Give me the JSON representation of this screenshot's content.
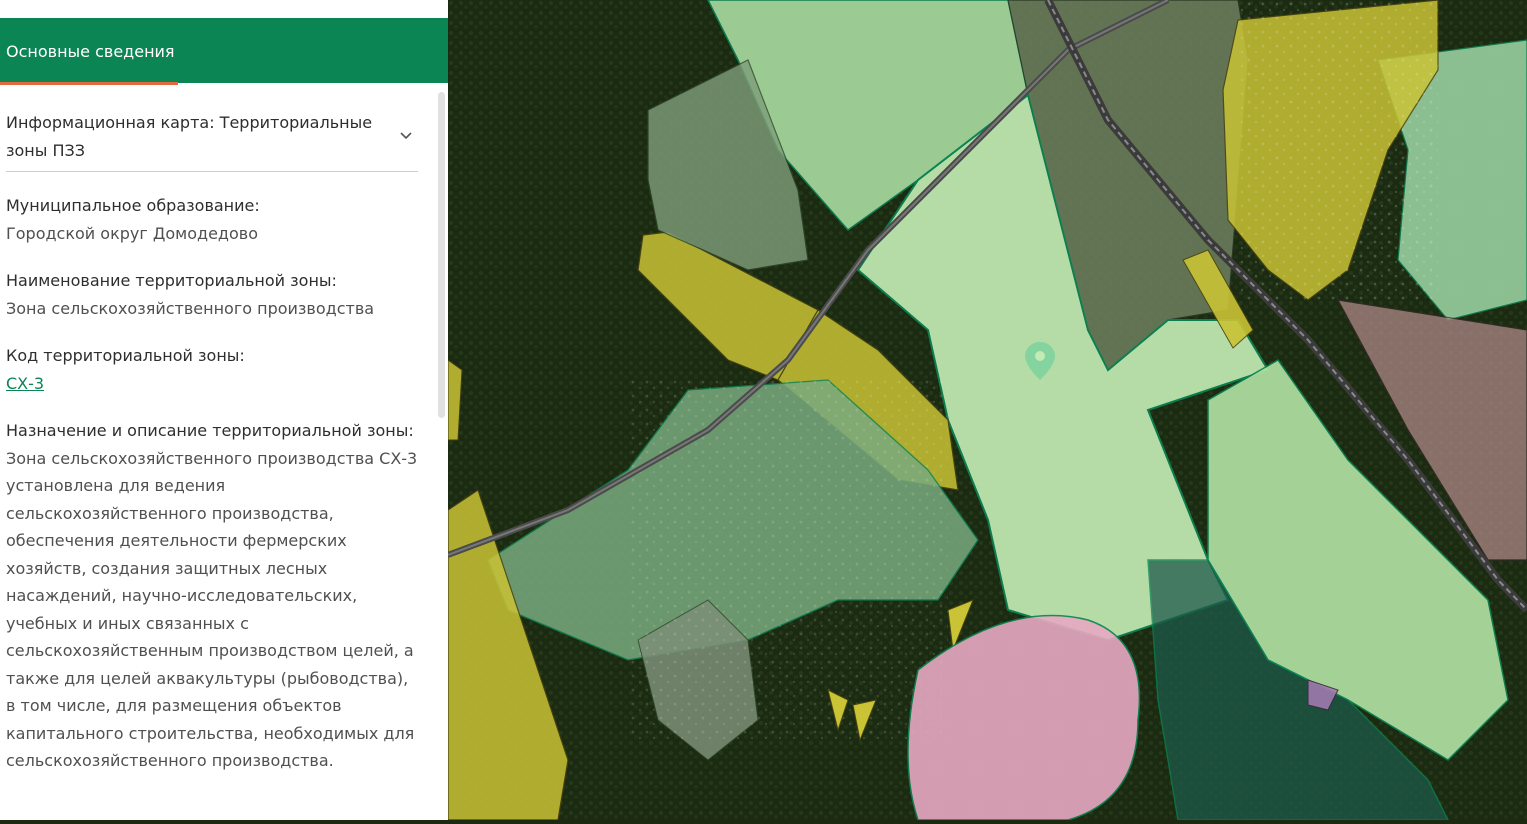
{
  "panel": {
    "header_title": "Основные сведения",
    "dropdown": "Информационная карта: Территориальные зоны ПЗЗ",
    "fields": [
      {
        "label": "Муниципальное образование:",
        "value": "Городской округ Домодедово"
      },
      {
        "label": "Наименование территориальной зоны:",
        "value": "Зона сельскохозяйственного производства"
      },
      {
        "label": "Код территориальной зоны:",
        "value": "СХ-3"
      },
      {
        "label": "Назначение и описание территориальной зоны:",
        "value": "Зона сельскохозяйственного производства СХ-3 установлена для ведения сельскохозяйственного производства, обеспечения деятельности фермерских хозяйств, создания защитных лесных насаждений, научно-исследовательских, учебных и иных связанных с сельскохозяйственным производством целей, а также для целей аквакультуры (рыбоводства), в том числе, для размещения объектов капитального строительства, необходимых для сельскохозяйственного производства."
      }
    ]
  },
  "map": {
    "marker_icon": "location-pin-icon",
    "colors": {
      "selected_zone": "#b7e6a6",
      "agricultural_zone": "#9fdc9b",
      "residential_zone": "#c9c335",
      "mixed_zone": "#7bb58c",
      "special_zone": "#e7a9c2",
      "forest": "#1b2b12",
      "road": "#4b4b4b",
      "accent": "#0b8553"
    }
  }
}
